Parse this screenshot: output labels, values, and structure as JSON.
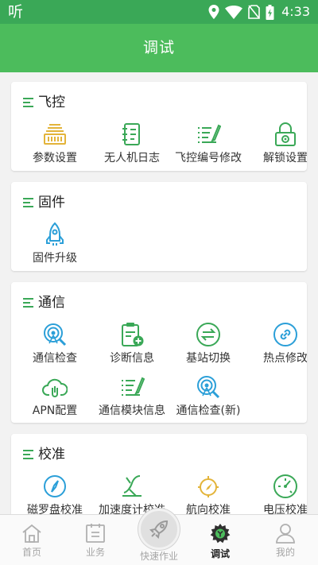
{
  "status_bar": {
    "app_glyph": "听",
    "icons": [
      "location-icon",
      "wifi-icon",
      "no-sim-icon",
      "battery-charging-icon"
    ],
    "time": "4:33"
  },
  "app_bar": {
    "title": "调试"
  },
  "colors": {
    "accent": "#4cbc5c",
    "status_bar": "#3aa857",
    "icon_blue": "#2b9fd8",
    "icon_green": "#3aa857",
    "icon_yellow": "#e3b43a"
  },
  "sections": [
    {
      "title": "飞控",
      "items": [
        {
          "label": "参数设置",
          "icon": "parameters-icon"
        },
        {
          "label": "无人机日志",
          "icon": "log-book-icon"
        },
        {
          "label": "飞控编号修改",
          "icon": "edit-list-icon"
        },
        {
          "label": "解锁设置",
          "icon": "unlock-icon"
        }
      ]
    },
    {
      "title": "固件",
      "items": [
        {
          "label": "固件升级",
          "icon": "rocket-icon"
        }
      ]
    },
    {
      "title": "通信",
      "items": [
        {
          "label": "通信检查",
          "icon": "signal-search-icon"
        },
        {
          "label": "诊断信息",
          "icon": "clipboard-add-icon"
        },
        {
          "label": "基站切换",
          "icon": "switch-arrows-icon"
        },
        {
          "label": "热点修改",
          "icon": "link-icon"
        },
        {
          "label": "APN配置",
          "icon": "cloud-link-icon"
        },
        {
          "label": "通信模块信息",
          "icon": "edit-list-icon"
        },
        {
          "label": "通信检查(新)",
          "icon": "signal-search-icon"
        }
      ]
    },
    {
      "title": "校准",
      "items": [
        {
          "label": "磁罗盘校准",
          "icon": "compass-icon"
        },
        {
          "label": "加速度计校准",
          "icon": "accelerometer-icon"
        },
        {
          "label": "航向校准",
          "icon": "heading-icon"
        },
        {
          "label": "电压校准",
          "icon": "gauge-icon"
        }
      ]
    }
  ],
  "bottom_nav": {
    "tabs": [
      {
        "label": "首页",
        "icon": "home-icon"
      },
      {
        "label": "业务",
        "icon": "calendar-icon"
      },
      {
        "label": "快速作业",
        "icon": "rocket-fab-icon"
      },
      {
        "label": "调试",
        "icon": "debug-gear-icon",
        "active": true
      },
      {
        "label": "我的",
        "icon": "person-icon"
      }
    ]
  }
}
